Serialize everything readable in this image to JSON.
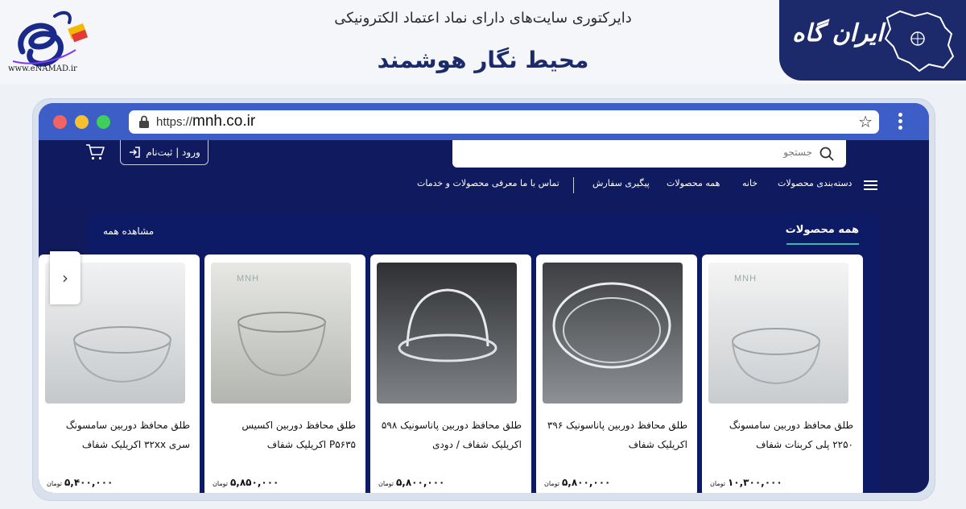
{
  "banner": {
    "enamad_url": "www.eNAMAD.ir",
    "directory_title": "دایرکتوری سایت‌های دارای نماد اعتماد الکترونیکی",
    "site_name": "محیط نگار هوشمند",
    "irangah_text": "ایران گاه"
  },
  "browser": {
    "url_prefix": "https://",
    "url_host": "mnh.co.ir"
  },
  "header": {
    "login_label": "ورود | ثبت‌نام",
    "search_placeholder": "جستجو"
  },
  "nav": {
    "categories": "دسته‌بندی محصولات",
    "home": "خانه",
    "all_products": "همه محصولات",
    "order_tracking": "پیگیری سفارش",
    "contact": "تماس با ما",
    "about": "معرفی محصولات و خدمات"
  },
  "section": {
    "title": "همه محصولات",
    "view_all": "مشاهده همه"
  },
  "products": [
    {
      "title": "طلق محافظ دوربین سامسونگ ۲۲۵۰ پلی کربنات شفاف",
      "price": "۱۰,۳۰۰,۰۰۰",
      "unit": "تومان"
    },
    {
      "title": "طلق محافظ دوربین پاناسونیک ۳۹۶ اکریلیک شفاف",
      "price": "۵,۸۰۰,۰۰۰",
      "unit": "تومان"
    },
    {
      "title": "طلق محافظ دوربین پاناسونیک ۵۹۸ اکریلیک شفاف / دودی",
      "price": "۵,۸۰۰,۰۰۰",
      "unit": "تومان"
    },
    {
      "title": "طلق محافظ دوربین اکسیس P۵۶۳۵ اکریلیک شفاف",
      "price": "۵,۸۵۰,۰۰۰",
      "unit": "تومان"
    },
    {
      "title": "طلق محافظ دوربین سامسونگ سری ۳۲xx اکریلیک شفاف",
      "price": "۵,۴۰۰,۰۰۰",
      "unit": "تومان"
    }
  ],
  "image_watermark": "MNH",
  "colors": {
    "browser_blue": "#3d5ec7",
    "site_navy": "#101a5c",
    "accent_teal": "#3fb7a9",
    "brand_navy": "#1c2a6c"
  }
}
